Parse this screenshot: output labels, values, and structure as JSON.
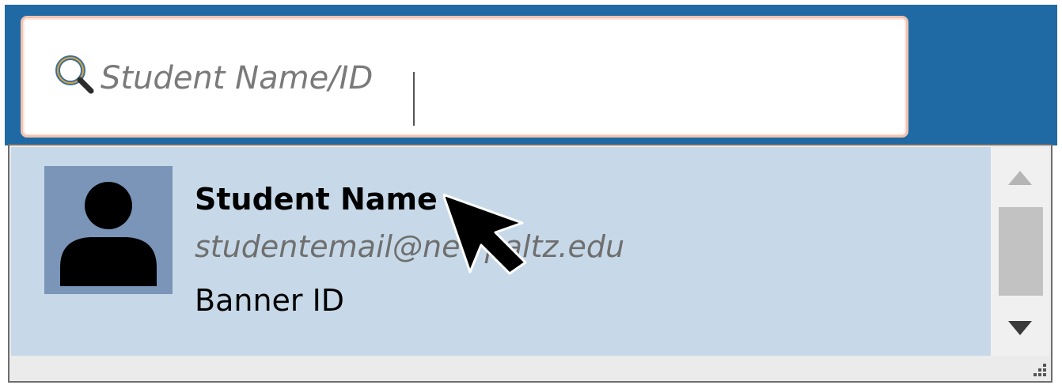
{
  "search": {
    "placeholder": "Student Name/ID",
    "value": "",
    "icon": "search-icon"
  },
  "results": [
    {
      "name": "Student Name",
      "email": "studentemail@newpaltz.edu",
      "banner_id": "Banner ID",
      "avatar_icon": "person-icon"
    }
  ],
  "colors": {
    "header": "#1f6aa5",
    "search_border": "#efc3b0",
    "result_highlight": "#c7d9e8",
    "avatar_bg": "#7a95b8",
    "email_text": "#6f6f6f"
  }
}
